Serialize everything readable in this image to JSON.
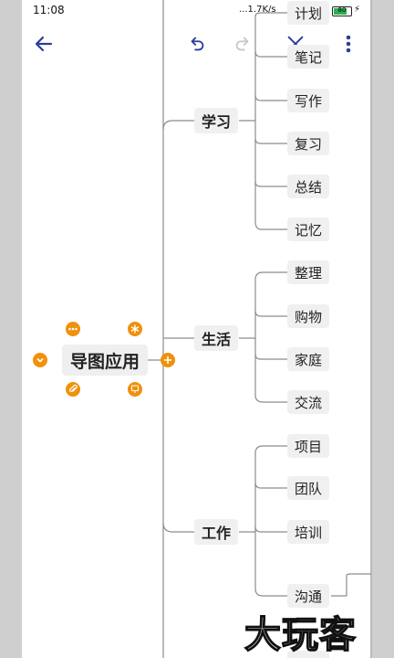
{
  "status_bar": {
    "time": "11:08",
    "network_speed": "...1.7K/s",
    "battery": "80"
  },
  "mindmap": {
    "root": "导图应用",
    "branches": [
      {
        "label": "学习",
        "children": [
          "计划",
          "笔记",
          "写作",
          "复习",
          "总结",
          "记忆"
        ]
      },
      {
        "label": "生活",
        "children": [
          "整理",
          "购物",
          "家庭",
          "交流"
        ]
      },
      {
        "label": "工作",
        "children": [
          "项目",
          "团队",
          "培训",
          "沟通"
        ]
      }
    ]
  },
  "watermark": "大玩客",
  "colors": {
    "accent": "#f0900c",
    "toolbar_icon": "#2c3e9c",
    "line": "#8c8c8c"
  }
}
